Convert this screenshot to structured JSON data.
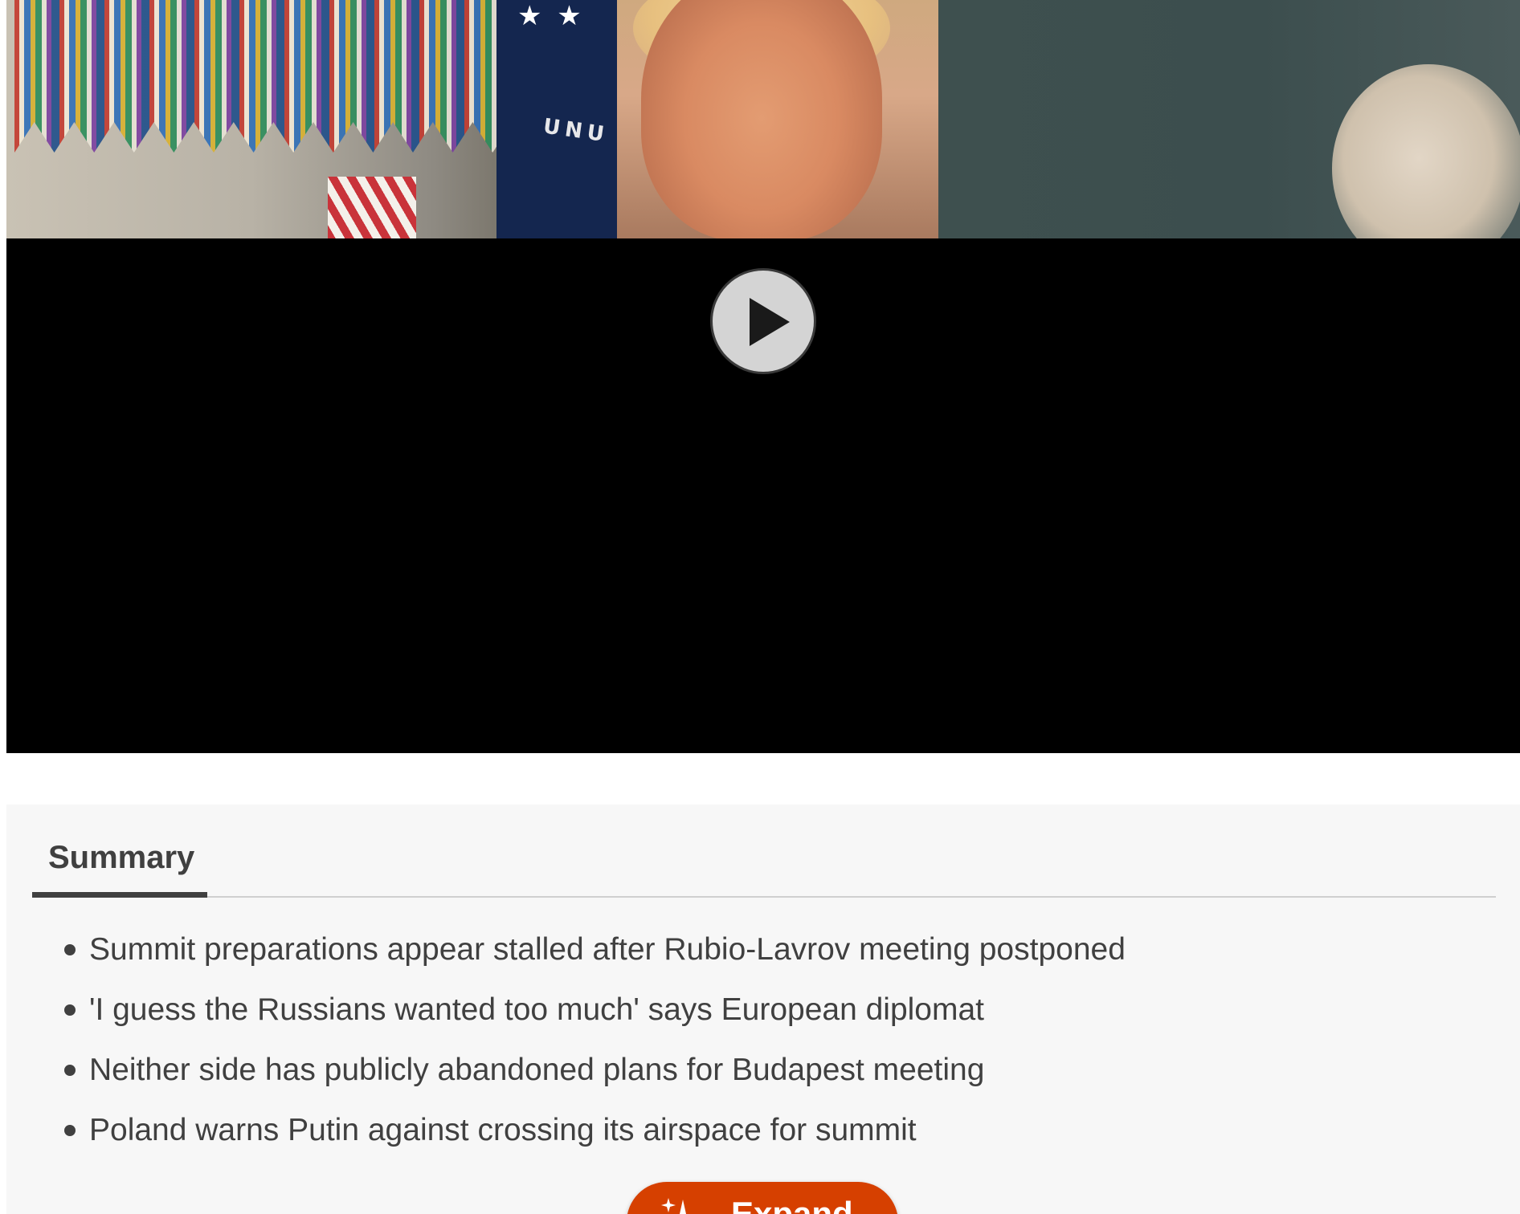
{
  "video": {
    "thumbnail_text": "UNU",
    "play_icon": "play-icon"
  },
  "summary": {
    "tab_label": "Summary",
    "bullets": [
      "Summit preparations appear stalled after Rubio-Lavrov meeting postponed",
      "'I guess the Russians wanted too much' says European diplomat",
      "Neither side has publicly abandoned plans for Budapest meeting",
      "Poland warns Putin against crossing its airspace for summit"
    ],
    "expand_button": {
      "label": "Expand",
      "icon": "sparkle-icon",
      "color": "#d64000"
    }
  },
  "colors": {
    "summary_background": "#f7f7f7",
    "text": "#404040",
    "video_background": "#000000"
  }
}
